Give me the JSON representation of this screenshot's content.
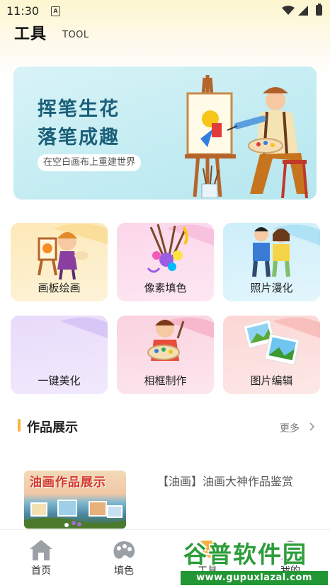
{
  "status": {
    "time": "11:30",
    "a_icon": "A"
  },
  "header": {
    "title": "工具",
    "subtitle": "TOOL"
  },
  "banner": {
    "line1": "挥笔生花",
    "line2": "落笔成趣",
    "tagline": "在空白画布上重建世界"
  },
  "tools": [
    {
      "label": "画板绘画",
      "icon": "easel-kid-icon",
      "color": "#fde9b8"
    },
    {
      "label": "像素填色",
      "icon": "paint-brushes-icon",
      "color": "#fbd6ea"
    },
    {
      "label": "照片漫化",
      "icon": "couple-cartoon-icon",
      "color": "#cdeefa"
    },
    {
      "label": "一键美化",
      "icon": "beautify-icon",
      "color": "#e8dbfa"
    },
    {
      "label": "相框制作",
      "icon": "painter-boy-icon",
      "color": "#fad2e0"
    },
    {
      "label": "图片编辑",
      "icon": "photos-icon",
      "color": "#fbd7d5"
    }
  ],
  "section": {
    "title": "作品展示",
    "more": "更多"
  },
  "post": {
    "thumb_title": "油画作品展示",
    "text": "【油画】油画大神作品鉴赏"
  },
  "tabs": [
    {
      "label": "首页",
      "icon": "home-icon"
    },
    {
      "label": "填色",
      "icon": "palette-icon"
    },
    {
      "label": "工具",
      "icon": "tool-icon"
    },
    {
      "label": "我的",
      "icon": "profile-icon"
    }
  ],
  "watermark": {
    "name": "谷普软件园",
    "url": "www.gupuxlazal.com"
  }
}
